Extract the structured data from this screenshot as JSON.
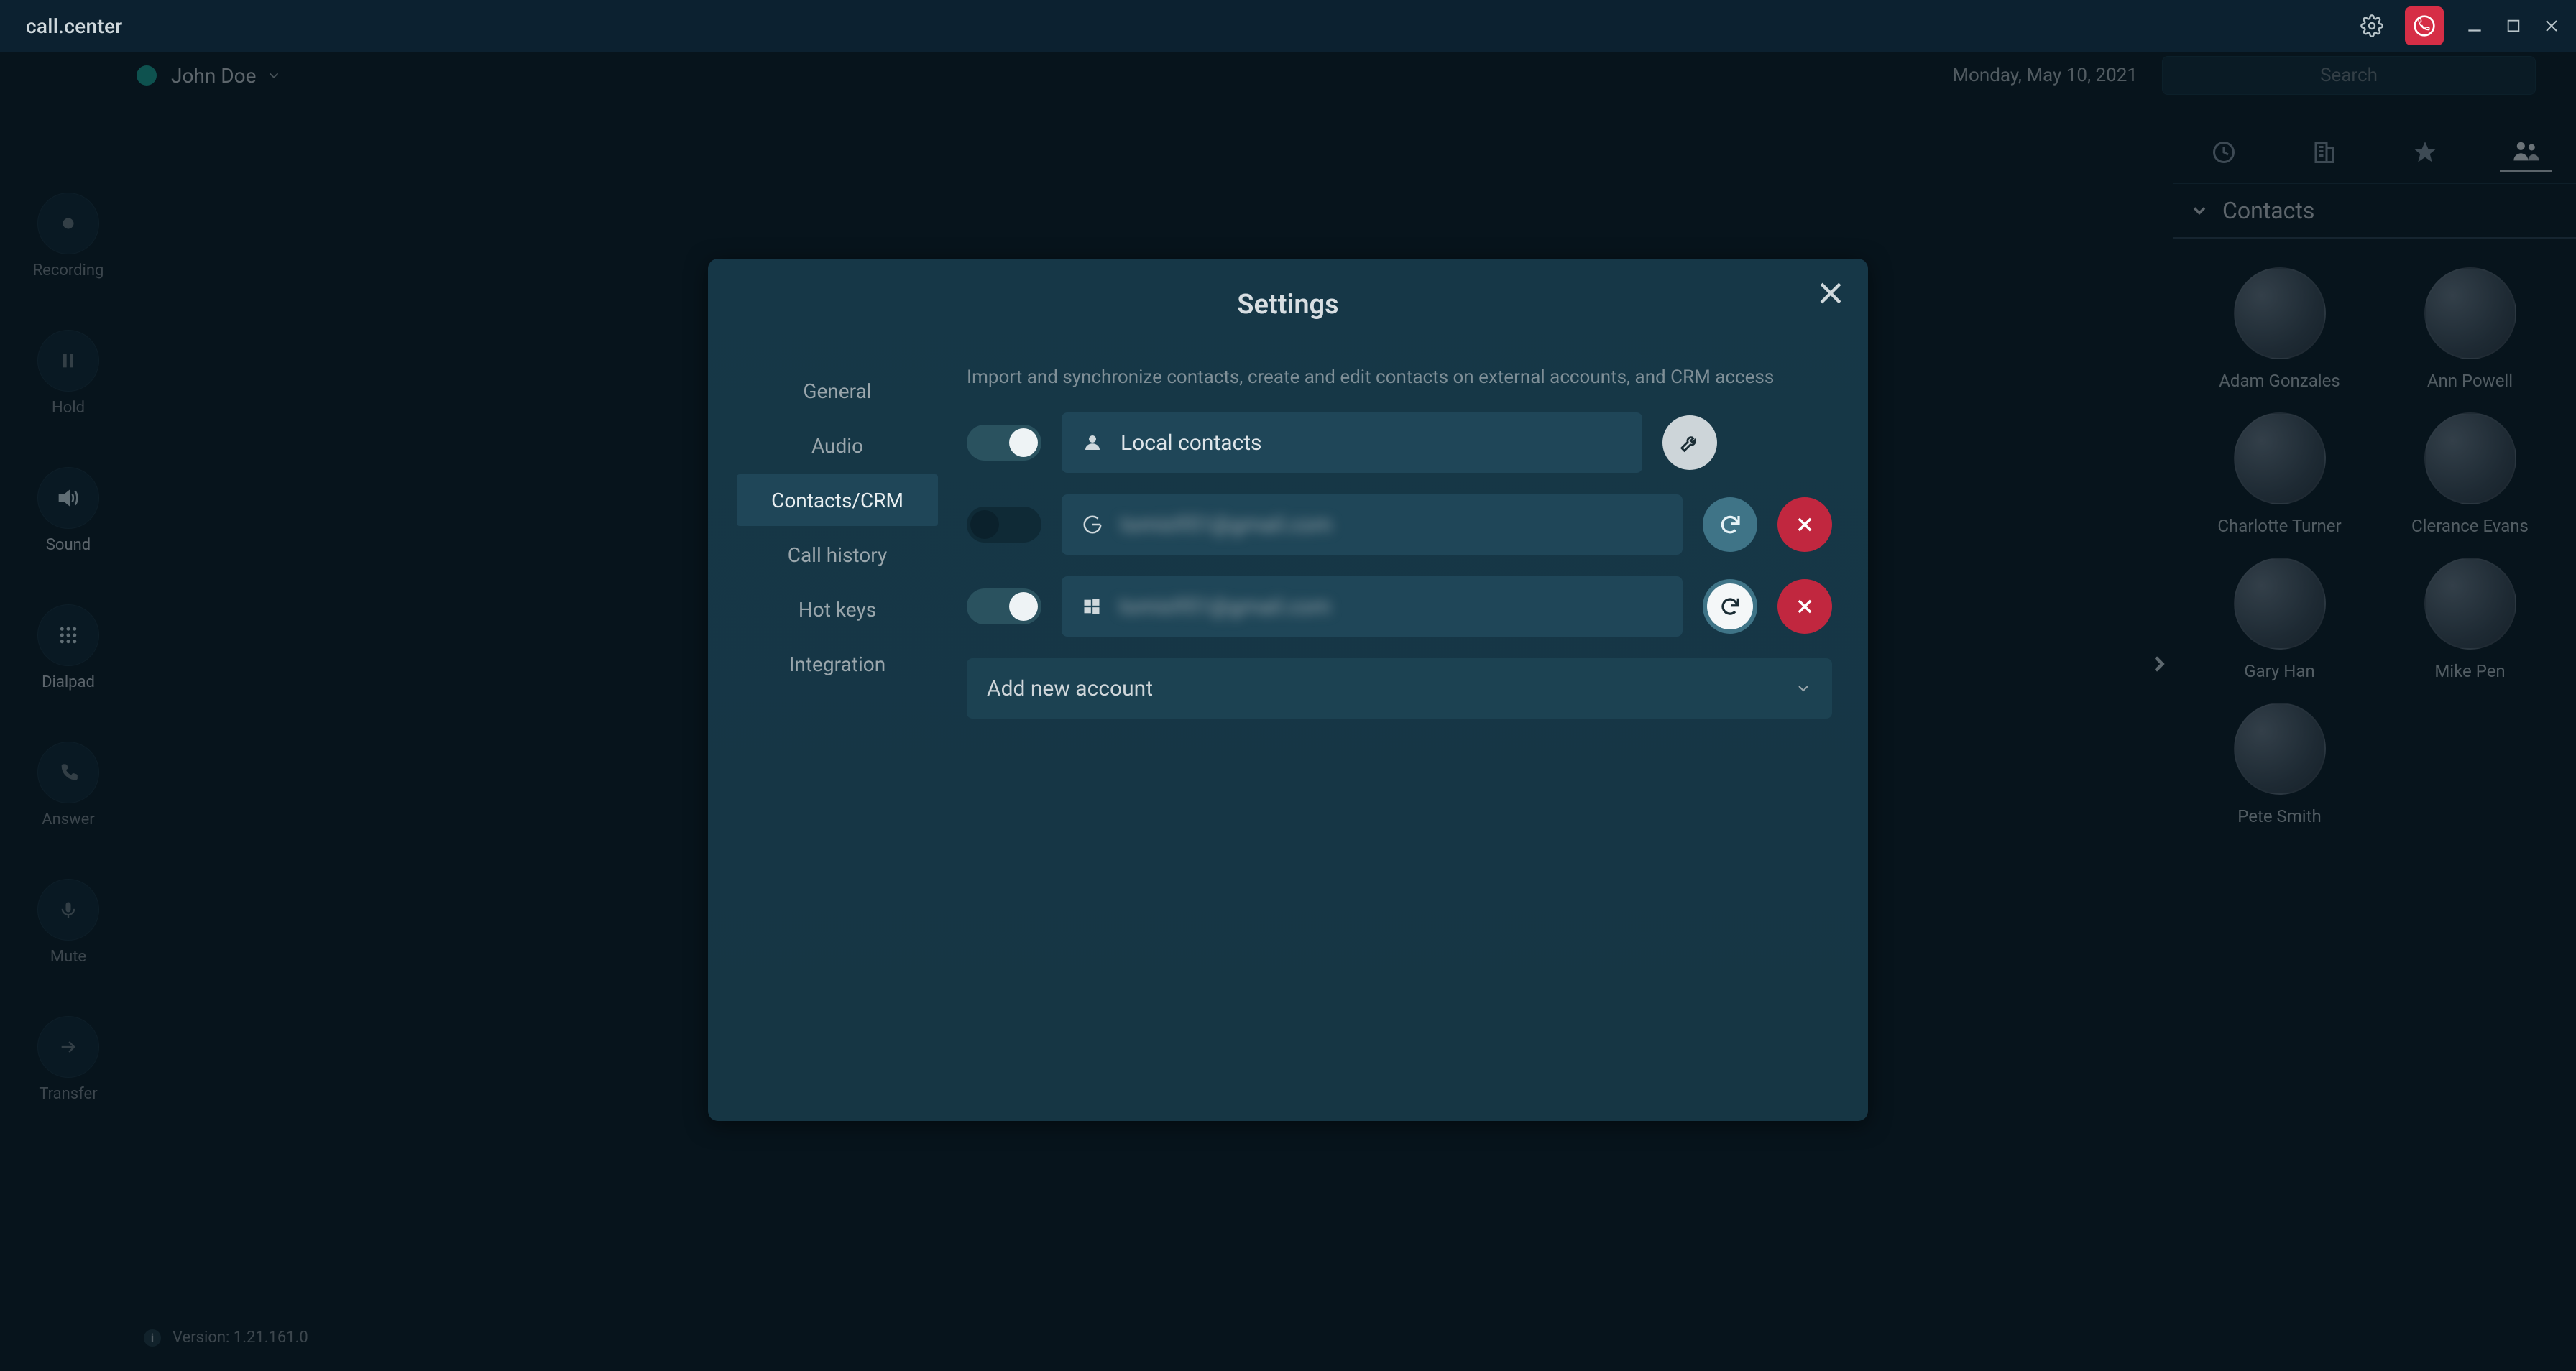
{
  "app": {
    "title": "call.center",
    "version_label": "Version: 1.21.161.0"
  },
  "titlebar": {
    "phone_color": "#d62e46"
  },
  "header": {
    "user": "John Doe",
    "date": "Monday, May 10, 2021",
    "search_placeholder": "Search"
  },
  "rail": {
    "items": [
      {
        "id": "recording",
        "label": "Recording"
      },
      {
        "id": "hold",
        "label": "Hold"
      },
      {
        "id": "sound",
        "label": "Sound"
      },
      {
        "id": "dialpad",
        "label": "Dialpad"
      },
      {
        "id": "answer",
        "label": "Answer"
      },
      {
        "id": "mute",
        "label": "Mute"
      },
      {
        "id": "transfer",
        "label": "Transfer"
      }
    ]
  },
  "right_tabs": [
    "recent",
    "company",
    "favorites",
    "contacts"
  ],
  "right": {
    "header": "Contacts"
  },
  "contacts": [
    {
      "name": "Adam Gonzales"
    },
    {
      "name": "Ann Powell"
    },
    {
      "name": "Charlotte Turner"
    },
    {
      "name": "Clerance Evans"
    },
    {
      "name": "Gary Han"
    },
    {
      "name": "Mike Pen"
    },
    {
      "name": "Pete Smith"
    }
  ],
  "modal": {
    "title": "Settings",
    "tabs": {
      "general": "General",
      "audio": "Audio",
      "contacts": "Contacts/CRM",
      "call_history": "Call history",
      "hot_keys": "Hot keys",
      "integration": "Integration"
    },
    "desc": "Import and synchronize contacts, create and edit contacts on external accounts, and CRM access",
    "accounts": [
      {
        "type": "local",
        "label": "Local contacts",
        "enabled": true,
        "blurred": false,
        "icon": "person",
        "buttons": [
          "wrench"
        ]
      },
      {
        "type": "google",
        "label": "tomis951@gmail.com",
        "enabled": false,
        "blurred": true,
        "icon": "google",
        "buttons": [
          "sync",
          "delete"
        ]
      },
      {
        "type": "windows",
        "label": "tomis951@gmail.com",
        "enabled": true,
        "blurred": true,
        "icon": "windows",
        "buttons": [
          "sync-white",
          "delete"
        ]
      }
    ],
    "add_label": "Add new account"
  }
}
